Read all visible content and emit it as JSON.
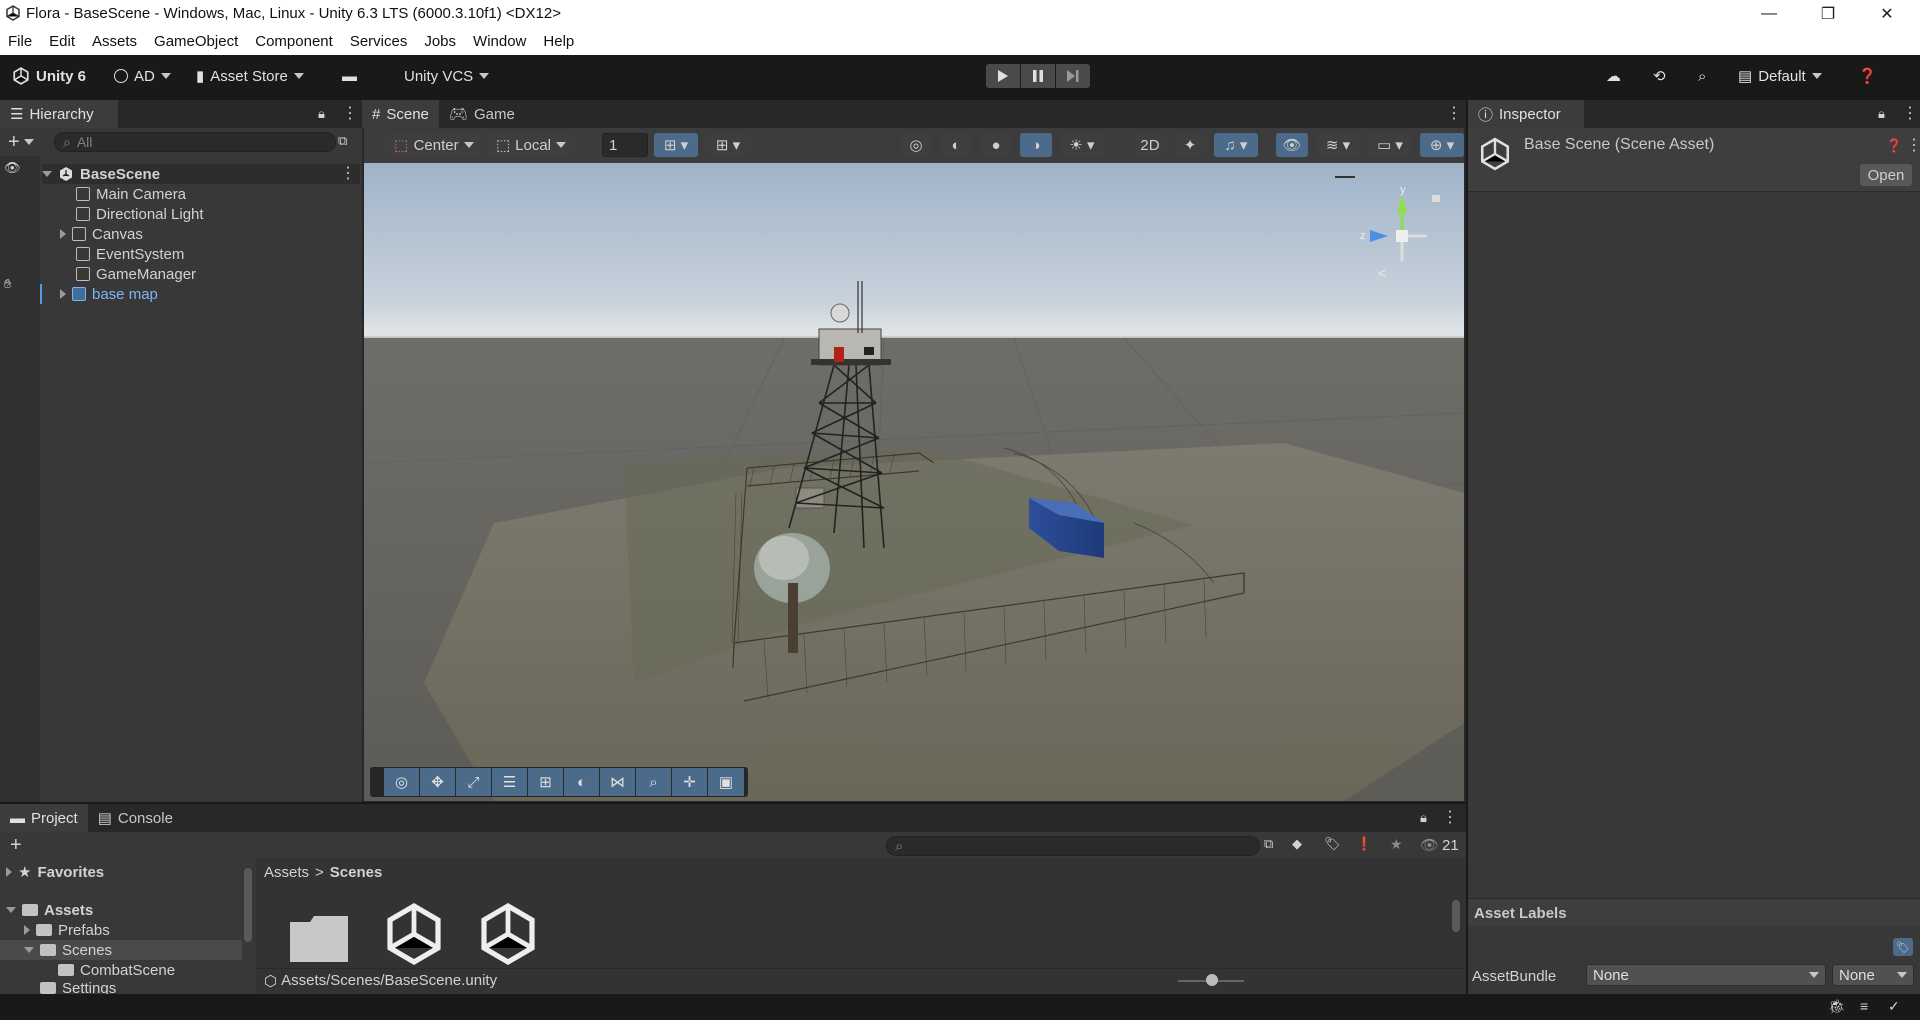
{
  "window": {
    "title": "Flora - BaseScene - Windows, Mac, Linux - Unity 6.3 LTS (6000.3.10f1) <DX12>",
    "minimize": "—",
    "restore": "❐",
    "close": "✕"
  },
  "menu": [
    "File",
    "Edit",
    "Assets",
    "GameObject",
    "Component",
    "Services",
    "Jobs",
    "Window",
    "Help"
  ],
  "toolbar": {
    "unity_label": "Unity 6",
    "account_label": "AD",
    "asset_store_label": "Asset Store",
    "vcs_label": "Unity VCS",
    "layout_label": "Default"
  },
  "hierarchy": {
    "tab_label": "Hierarchy",
    "search_placeholder": "All",
    "scene_name": "BaseScene",
    "items": [
      {
        "label": "Main Camera",
        "expandable": false
      },
      {
        "label": "Directional Light",
        "expandable": false
      },
      {
        "label": "Canvas",
        "expandable": true
      },
      {
        "label": "EventSystem",
        "expandable": false
      },
      {
        "label": "GameManager",
        "expandable": false
      },
      {
        "label": "base map",
        "expandable": true
      }
    ]
  },
  "scene": {
    "tab_scene": "Scene",
    "tab_game": "Game",
    "pivot_label": "Center",
    "space_label": "Local",
    "snap_value": "1"
  },
  "inspector": {
    "tab_label": "Inspector",
    "title": "Base Scene (Scene Asset)",
    "open_button": "Open",
    "asset_labels": "Asset Labels",
    "assetbundle_label": "AssetBundle",
    "assetbundle_value": "None",
    "variant_value": "None"
  },
  "project": {
    "tab_project": "Project",
    "tab_console": "Console",
    "visible_count": "21",
    "favorites": "Favorites",
    "tree": {
      "assets": "Assets",
      "prefabs": "Prefabs",
      "scenes": "Scenes",
      "combat_scene": "CombatScene",
      "settings": "Settings"
    },
    "breadcrumb_root": "Assets",
    "breadcrumb_sep": ">",
    "breadcrumb_current": "Scenes",
    "selected_path": "Assets/Scenes/BaseScene.unity"
  },
  "colors": {
    "selection_blue": "#7cb6f2",
    "accent_tab": "#4c6a8a"
  }
}
